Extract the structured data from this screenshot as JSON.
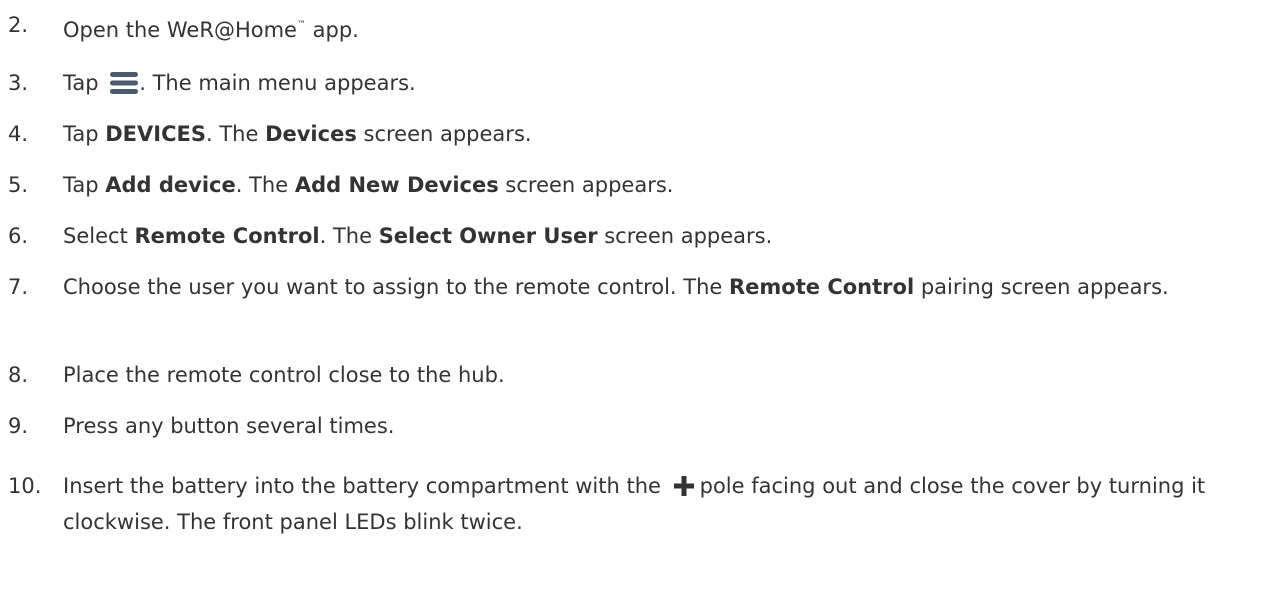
{
  "steps": [
    {
      "number": "2.",
      "parts": [
        "Open the WeR@Home",
        "™",
        " app."
      ]
    },
    {
      "number": "3.",
      "parts": [
        "Tap ",
        ". The main menu appears."
      ],
      "icon": "hamburger-menu-icon"
    },
    {
      "number": "4.",
      "parts": [
        "Tap ",
        "DEVICES",
        ". The ",
        "Devices",
        " screen appears."
      ]
    },
    {
      "number": "5.",
      "parts": [
        "Tap ",
        "Add device",
        ". The ",
        "Add New Devices",
        " screen appears."
      ]
    },
    {
      "number": "6.",
      "parts": [
        "Select ",
        "Remote Control",
        ". The ",
        "Select Owner User",
        " screen appears."
      ]
    },
    {
      "number": "7.",
      "parts": [
        "Choose the user you want to assign to the remote control. The ",
        "Remote Control",
        " pairing screen appears."
      ]
    },
    {
      "number": "8.",
      "parts": [
        "Place the remote control close to the hub."
      ]
    },
    {
      "number": "9.",
      "parts": [
        "Press any button several times."
      ]
    },
    {
      "number": "10.",
      "parts": [
        "Insert the battery into the battery compartment with the ",
        "pole facing out and close the cover by turning it clockwise. The front panel LEDs blink twice."
      ],
      "icon": "plus-icon"
    }
  ],
  "colors": {
    "text": "#333333",
    "icon": "#4a5a6a"
  }
}
